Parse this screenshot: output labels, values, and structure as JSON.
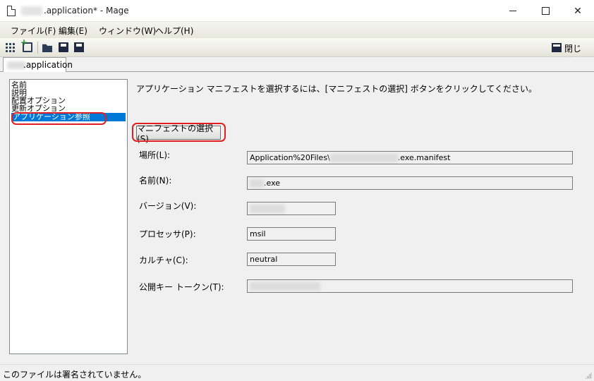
{
  "window": {
    "title": ".application* - Mage",
    "controls": {
      "minimize": "minimize-icon",
      "maximize": "maximize-icon",
      "close": "close-icon"
    }
  },
  "menu": [
    "ファイル(F)",
    "編集(E)",
    "ウィンドウ(W)",
    "ヘルプ(H)"
  ],
  "toolbar": {
    "icons": [
      "new-grid-icon",
      "new-add-icon",
      "open-folder-icon",
      "save-icon",
      "save-all-icon"
    ],
    "close_label": "閉じる"
  },
  "tab": {
    "label": ".application"
  },
  "nav": {
    "items": [
      "名前",
      "説明",
      "配置オプション",
      "更新オプション",
      "アプリケーション参照"
    ],
    "selected_index": 4
  },
  "main": {
    "description": "アプリケーション マニフェストを選択するには、[マニフェストの選択] ボタンをクリックしてください。",
    "select_button": "マニフェストの選択(S)...",
    "fields": {
      "location": {
        "label": "場所(L):",
        "value_prefix": "Application%20Files\\",
        "value_suffix": ".exe.manifest"
      },
      "name": {
        "label": "名前(N):",
        "value_suffix": ".exe"
      },
      "version": {
        "label": "バージョン(V):",
        "value": ""
      },
      "processor": {
        "label": "プロセッサ(P):",
        "value": "msil"
      },
      "culture": {
        "label": "カルチャ(C):",
        "value": "neutral"
      },
      "public_key_token": {
        "label": "公開キー トークン(T):",
        "value": ""
      }
    }
  },
  "status": {
    "text": "このファイルは署名されていません。"
  },
  "colors": {
    "selection": "#0078d7",
    "highlight_outline": "#e0201f",
    "window_bg": "#f0f0f0"
  }
}
